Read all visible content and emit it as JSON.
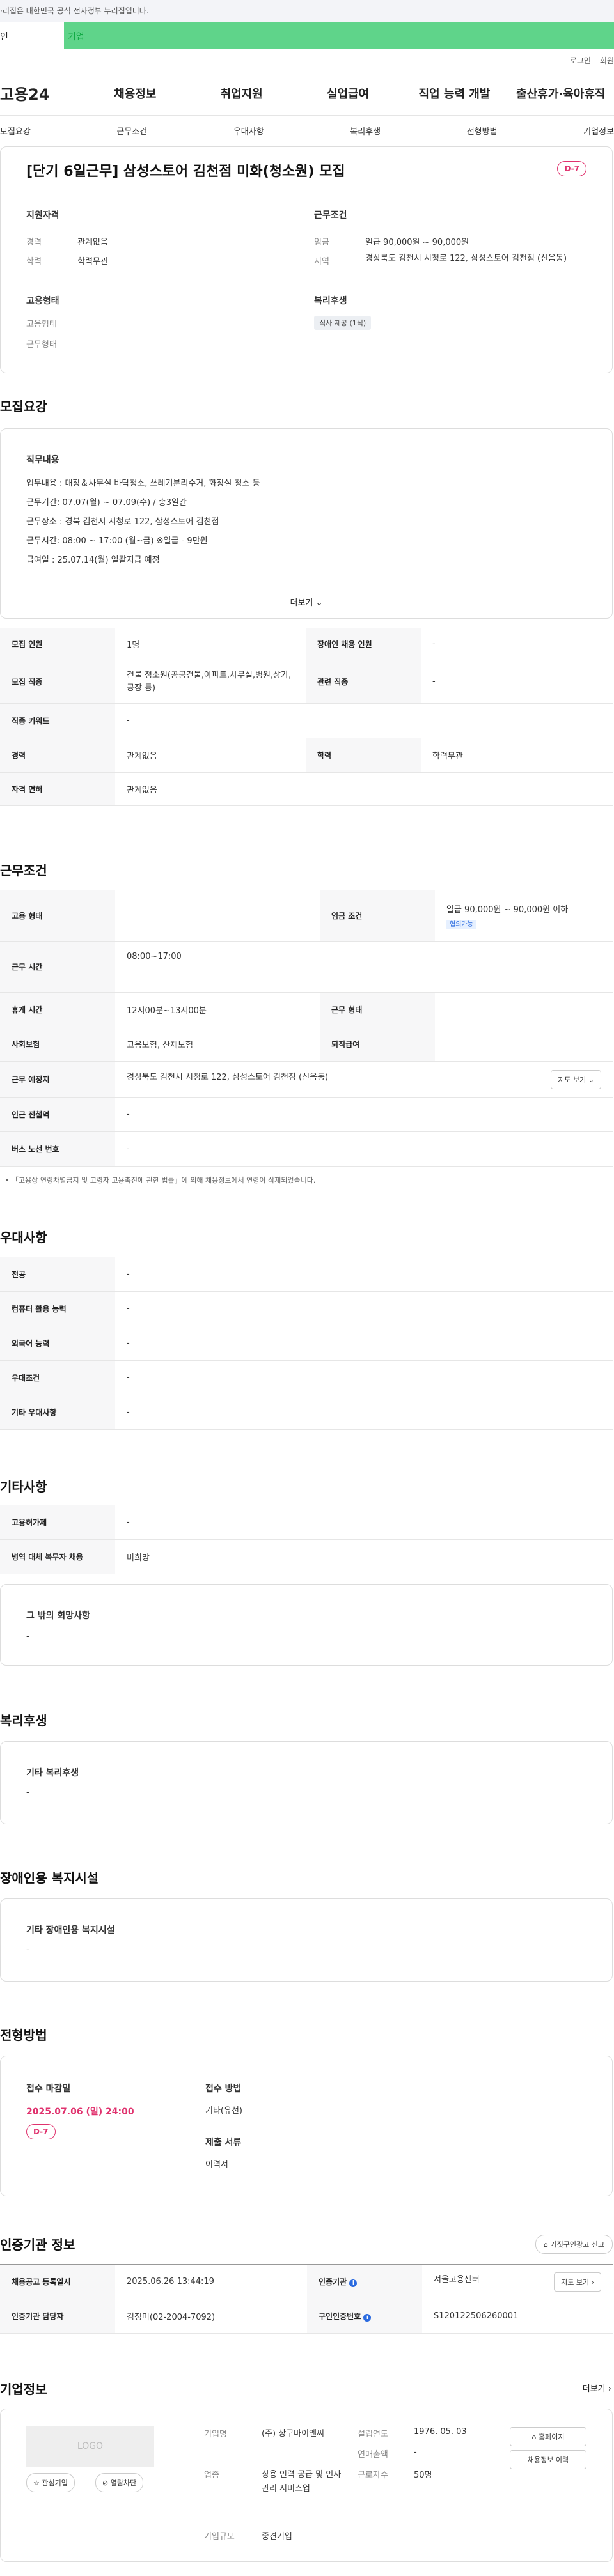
{
  "gov_banner": "·리집은 대한민국 공식 전자정부 누리집입니다.",
  "tabs": [
    "인",
    "기업"
  ],
  "util": [
    "로그인",
    "회원"
  ],
  "logo": "고용24",
  "gnb": [
    "채용정보",
    "취업지원",
    "실업급여",
    "직업 능력 개발",
    "출산휴가·육아휴직"
  ],
  "lnb": [
    "모집요강",
    "근무조건",
    "우대사항",
    "복리후생",
    "전형방법",
    "기업정보"
  ],
  "job": {
    "title": "[단기 6일근무] 삼성스토어 김천점 미화(청소원) 모집",
    "dday": "D-7",
    "qual_title": "지원자격",
    "career_l": "경력",
    "career_v": "관계없음",
    "edu_l": "학력",
    "edu_v": "학력무관",
    "cond_title": "근무조건",
    "wage_l": "임금",
    "wage_v": "일급 90,000원 ~ 90,000원",
    "loc_l": "지역",
    "loc_v": "경상북도 김천시 시청로 122, 삼성스토어 김천점 (신음동)",
    "emp_title": "고용형태",
    "emp_l1": "고용형태",
    "emp_l2": "근무형태",
    "welfare_title": "복리후생",
    "welfare_badge": "식사 제공 (1식)"
  },
  "recruit": {
    "title": "모집요강",
    "box_title": "직무내용",
    "lines": [
      "업무내용 : 매장＆사무실 바닥청소, 쓰레기분리수거, 화장실 청소 등",
      "근무기간: 07.07(월) ~ 07.09(수) / 총3일간",
      "근무장소 : 경북 김천시 시청로 122, 삼성스토어 김천점",
      "근무시간: 08:00 ~ 17:00 (월~금) ※일급 - 9만원",
      "급여일 : 25.07.14(월) 일괄지급 예정"
    ],
    "more": "더보기",
    "rows": [
      [
        "모집 인원",
        "1명",
        "장애인 채용 인원",
        "-"
      ],
      [
        "모집 직종",
        "건물 청소원(공공건물,아파트,사무실,병원,상가,공장 등)",
        "관련 직종",
        "-"
      ],
      [
        "직종 키워드",
        "-"
      ],
      [
        "경력",
        "관계없음",
        "학력",
        "학력무관"
      ],
      [
        "자격 면허",
        "관계없음"
      ]
    ]
  },
  "cond": {
    "title": "근무조건",
    "emp_l": "고용 형태",
    "wage_l": "임금 조건",
    "wage_v": "일급 90,000원 ~ 90,000원 이하",
    "wage_tag": "협의가능",
    "time_l": "근무 시간",
    "time_v": "08:00~17:00",
    "rest_l": "휴게 시간",
    "rest_v": "12시00분~13시00분",
    "form_l": "근무 형태",
    "ins_l": "사회보험",
    "ins_v": "고용보험, 산재보험",
    "ret_l": "퇴직급여",
    "place_l": "근무 예정지",
    "place_v": "경상북도 김천시 시청로 122, 삼성스토어 김천점 (신음동)",
    "map_btn": "지도 보기",
    "sub_l": "인근 전철역",
    "sub_v": "-",
    "bus_l": "버스 노선 번호",
    "bus_v": "-",
    "note": "「고용상 연령차별금지 및 고령자 고용촉진에 관한 법률」에 의해 채용정보에서 연령이 삭제되었습니다."
  },
  "pref": {
    "title": "우대사항",
    "rows": [
      [
        "전공",
        "-"
      ],
      [
        "컴퓨터 활용 능력",
        "-"
      ],
      [
        "외국어 능력",
        "-"
      ],
      [
        "우대조건",
        "-"
      ],
      [
        "기타 우대사항",
        "-"
      ]
    ]
  },
  "etc": {
    "title": "기타사항",
    "rows": [
      [
        "고용허가제",
        "-"
      ],
      [
        "병역 대체 복무자 채용",
        "비희망"
      ]
    ],
    "box_title": "그 밖의 희망사항",
    "box_val": "-"
  },
  "welfare": {
    "title": "복리후생",
    "box_title": "기타 복리후생",
    "box_val": "-"
  },
  "disab": {
    "title": "장애인용 복지시설",
    "box_title": "기타 장애인용 복지시설",
    "box_val": "-"
  },
  "screen": {
    "title": "전형방법",
    "deadline_l": "접수 마감일",
    "deadline_v": "2025.07.06 (일) 24:00",
    "dday": "D-7",
    "method_l": "접수 방법",
    "method_v": "기타(유선)",
    "docs_l": "제출 서류",
    "docs_v": "이력서"
  },
  "auth": {
    "title": "인증기관 정보",
    "report_btn": "거짓구인광고 신고",
    "r1": [
      "채용공고 등록일시",
      "2025.06.26 13:44:19",
      "인증기관",
      "서울고용센터"
    ],
    "map_btn": "지도 보기",
    "r2": [
      "인증기관 담당자",
      "김정미(02-2004-7092)",
      "구인인증번호",
      "S120122506260001"
    ]
  },
  "company": {
    "title": "기업정보",
    "more": "더보기",
    "logo": "LOGO",
    "fav": "관심기업",
    "block": "열람차단",
    "name_l": "기업명",
    "name_v": "(주) 상구마이엔씨",
    "ind_l": "업종",
    "ind_v": "상용 인력 공급 및 인사관리 서비스업",
    "size_l": "기업규모",
    "size_v": "중견기업",
    "year_l": "설립연도",
    "year_v": "1976. 05. 03",
    "sales_l": "연매출액",
    "sales_v": "-",
    "emp_l": "근로자수",
    "emp_v": "50명",
    "home_btn": "홈페이지",
    "jobs_btn": "채용정보 이력"
  }
}
